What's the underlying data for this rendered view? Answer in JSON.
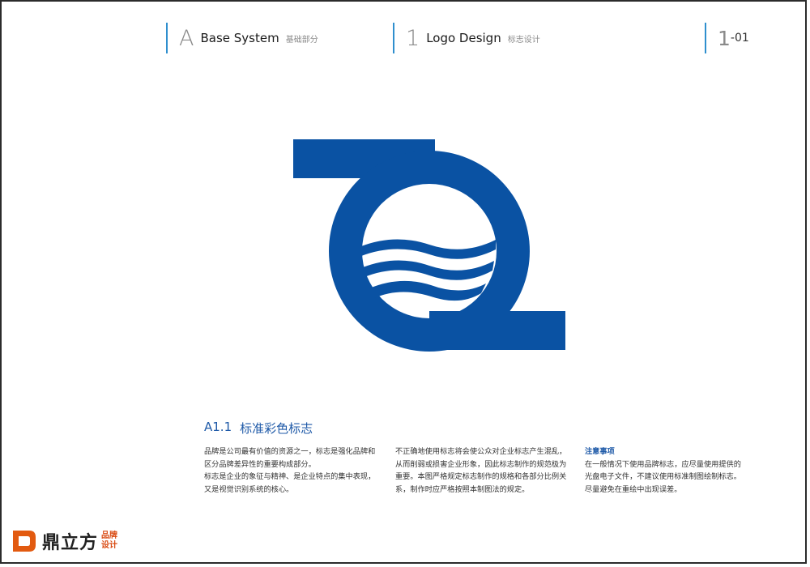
{
  "header": {
    "section_letter": "A",
    "section_title": "Base System",
    "section_sub": "基础部分",
    "chapter_num": "1",
    "chapter_title": "Logo Design",
    "chapter_sub": "标志设计",
    "page_big": "1",
    "page_small": "-01"
  },
  "colors": {
    "brand_blue": "#0a52a3",
    "accent_line": "#2f8fce",
    "heading_blue": "#1f5aa8",
    "brand_orange": "#e25a10"
  },
  "section": {
    "number": "A1.1",
    "title": "标准彩色标志"
  },
  "columns": {
    "col1": [
      "品牌是公司最有价值的资源之一，标志是强化品牌和",
      "区分品牌差异性的重要构成部分。",
      "标志是企业的象征与精神、是企业特点的集中表现，",
      "又是视觉识别系统的核心。"
    ],
    "col2": [
      "不正确地使用标志将会使公众对企业标志产生混乱，",
      "从而削弱或损害企业形象，因此标志制作的规范极为",
      "重要。本图严格规定标志制作的规格和各部分比例关",
      "系，制作时应严格按照本制图法的规定。"
    ],
    "note_title": "注意事项",
    "col3": [
      "在一般情况下使用品牌标志，应尽量使用提供的",
      "光盘电子文件，不建议使用标准制图绘制标志。",
      "尽量避免在重绘中出现误差。"
    ]
  },
  "brand": {
    "name": "鼎立方",
    "sub_line1": "品牌",
    "sub_line2": "设计",
    "icon": "d-square-logo-icon"
  }
}
